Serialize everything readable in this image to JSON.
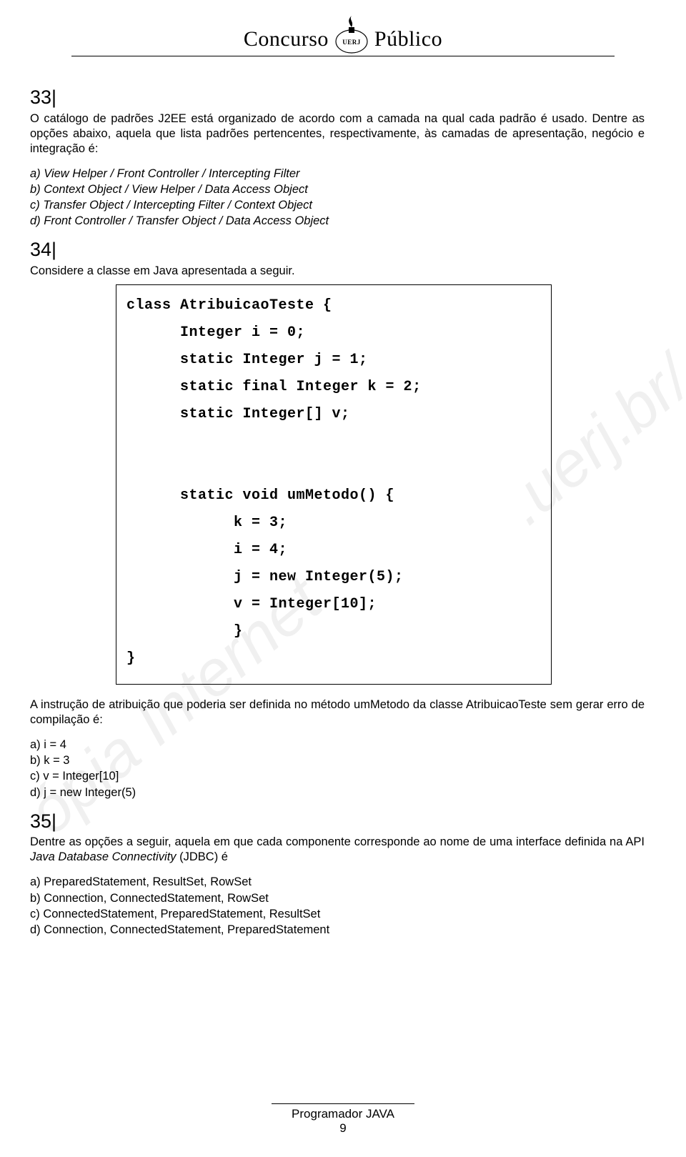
{
  "header": {
    "title_left": "Concurso",
    "title_right": "Público",
    "org": "UERJ"
  },
  "watermark1": ".uerj.br/",
  "watermark2": "ópia Internet",
  "q33": {
    "num": "33|",
    "text": "O catálogo de padrões J2EE está organizado de acordo com a camada na qual cada padrão é usado. Dentre as opções abaixo, aquela que lista padrões pertencentes, respectivamente, às camadas de apresentação, negócio e integração é:",
    "a": "a) View Helper / Front Controller / Intercepting Filter",
    "b": "b) Context Object / View Helper / Data Access Object",
    "c": "c) Transfer Object / Intercepting Filter / Context Object",
    "d": "d) Front Controller / Transfer Object / Data Access Object"
  },
  "q34": {
    "num": "34|",
    "intro": "Considere a classe em Java apresentada a seguir.",
    "code": "class AtribuicaoTeste {\n      Integer i = 0;\n      static Integer j = 1;\n      static final Integer k = 2;\n      static Integer[] v;\n\n\n      static void umMetodo() {\n            k = 3;\n            i = 4;\n            j = new Integer(5);\n            v = Integer[10];\n            }\n}",
    "text2": "A instrução de atribuição que poderia ser definida no método umMetodo da classe AtribuicaoTeste sem gerar erro de compilação é:",
    "a": "a) i = 4",
    "b": "b) k = 3",
    "c": "c) v = Integer[10]",
    "d": "d) j = new Integer(5)"
  },
  "q35": {
    "num": "35|",
    "text_part1": "Dentre as opções a seguir, aquela em que cada componente corresponde ao nome de uma interface definida na API ",
    "text_italic": "Java Database Connectivity",
    "text_part2": " (JDBC) é",
    "a": "a) PreparedStatement, ResultSet, RowSet",
    "b": "b) Connection, ConnectedStatement, RowSet",
    "c": "c) ConnectedStatement, PreparedStatement, ResultSet",
    "d": "d) Connection, ConnectedStatement, PreparedStatement"
  },
  "footer": {
    "title": "Programador JAVA",
    "page": "9"
  }
}
